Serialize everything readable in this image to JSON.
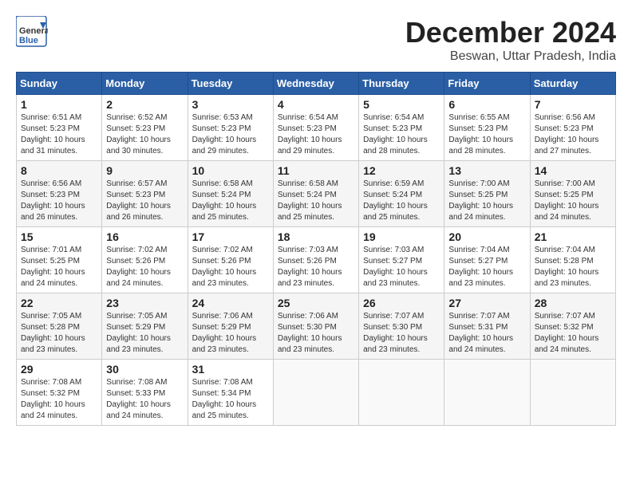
{
  "header": {
    "logo_general": "General",
    "logo_blue": "Blue",
    "month_year": "December 2024",
    "location": "Beswan, Uttar Pradesh, India"
  },
  "weekdays": [
    "Sunday",
    "Monday",
    "Tuesday",
    "Wednesday",
    "Thursday",
    "Friday",
    "Saturday"
  ],
  "weeks": [
    [
      {
        "day": "1",
        "info": "Sunrise: 6:51 AM\nSunset: 5:23 PM\nDaylight: 10 hours\nand 31 minutes."
      },
      {
        "day": "2",
        "info": "Sunrise: 6:52 AM\nSunset: 5:23 PM\nDaylight: 10 hours\nand 30 minutes."
      },
      {
        "day": "3",
        "info": "Sunrise: 6:53 AM\nSunset: 5:23 PM\nDaylight: 10 hours\nand 29 minutes."
      },
      {
        "day": "4",
        "info": "Sunrise: 6:54 AM\nSunset: 5:23 PM\nDaylight: 10 hours\nand 29 minutes."
      },
      {
        "day": "5",
        "info": "Sunrise: 6:54 AM\nSunset: 5:23 PM\nDaylight: 10 hours\nand 28 minutes."
      },
      {
        "day": "6",
        "info": "Sunrise: 6:55 AM\nSunset: 5:23 PM\nDaylight: 10 hours\nand 28 minutes."
      },
      {
        "day": "7",
        "info": "Sunrise: 6:56 AM\nSunset: 5:23 PM\nDaylight: 10 hours\nand 27 minutes."
      }
    ],
    [
      {
        "day": "8",
        "info": "Sunrise: 6:56 AM\nSunset: 5:23 PM\nDaylight: 10 hours\nand 26 minutes."
      },
      {
        "day": "9",
        "info": "Sunrise: 6:57 AM\nSunset: 5:23 PM\nDaylight: 10 hours\nand 26 minutes."
      },
      {
        "day": "10",
        "info": "Sunrise: 6:58 AM\nSunset: 5:24 PM\nDaylight: 10 hours\nand 25 minutes."
      },
      {
        "day": "11",
        "info": "Sunrise: 6:58 AM\nSunset: 5:24 PM\nDaylight: 10 hours\nand 25 minutes."
      },
      {
        "day": "12",
        "info": "Sunrise: 6:59 AM\nSunset: 5:24 PM\nDaylight: 10 hours\nand 25 minutes."
      },
      {
        "day": "13",
        "info": "Sunrise: 7:00 AM\nSunset: 5:25 PM\nDaylight: 10 hours\nand 24 minutes."
      },
      {
        "day": "14",
        "info": "Sunrise: 7:00 AM\nSunset: 5:25 PM\nDaylight: 10 hours\nand 24 minutes."
      }
    ],
    [
      {
        "day": "15",
        "info": "Sunrise: 7:01 AM\nSunset: 5:25 PM\nDaylight: 10 hours\nand 24 minutes."
      },
      {
        "day": "16",
        "info": "Sunrise: 7:02 AM\nSunset: 5:26 PM\nDaylight: 10 hours\nand 24 minutes."
      },
      {
        "day": "17",
        "info": "Sunrise: 7:02 AM\nSunset: 5:26 PM\nDaylight: 10 hours\nand 23 minutes."
      },
      {
        "day": "18",
        "info": "Sunrise: 7:03 AM\nSunset: 5:26 PM\nDaylight: 10 hours\nand 23 minutes."
      },
      {
        "day": "19",
        "info": "Sunrise: 7:03 AM\nSunset: 5:27 PM\nDaylight: 10 hours\nand 23 minutes."
      },
      {
        "day": "20",
        "info": "Sunrise: 7:04 AM\nSunset: 5:27 PM\nDaylight: 10 hours\nand 23 minutes."
      },
      {
        "day": "21",
        "info": "Sunrise: 7:04 AM\nSunset: 5:28 PM\nDaylight: 10 hours\nand 23 minutes."
      }
    ],
    [
      {
        "day": "22",
        "info": "Sunrise: 7:05 AM\nSunset: 5:28 PM\nDaylight: 10 hours\nand 23 minutes."
      },
      {
        "day": "23",
        "info": "Sunrise: 7:05 AM\nSunset: 5:29 PM\nDaylight: 10 hours\nand 23 minutes."
      },
      {
        "day": "24",
        "info": "Sunrise: 7:06 AM\nSunset: 5:29 PM\nDaylight: 10 hours\nand 23 minutes."
      },
      {
        "day": "25",
        "info": "Sunrise: 7:06 AM\nSunset: 5:30 PM\nDaylight: 10 hours\nand 23 minutes."
      },
      {
        "day": "26",
        "info": "Sunrise: 7:07 AM\nSunset: 5:30 PM\nDaylight: 10 hours\nand 23 minutes."
      },
      {
        "day": "27",
        "info": "Sunrise: 7:07 AM\nSunset: 5:31 PM\nDaylight: 10 hours\nand 24 minutes."
      },
      {
        "day": "28",
        "info": "Sunrise: 7:07 AM\nSunset: 5:32 PM\nDaylight: 10 hours\nand 24 minutes."
      }
    ],
    [
      {
        "day": "29",
        "info": "Sunrise: 7:08 AM\nSunset: 5:32 PM\nDaylight: 10 hours\nand 24 minutes."
      },
      {
        "day": "30",
        "info": "Sunrise: 7:08 AM\nSunset: 5:33 PM\nDaylight: 10 hours\nand 24 minutes."
      },
      {
        "day": "31",
        "info": "Sunrise: 7:08 AM\nSunset: 5:34 PM\nDaylight: 10 hours\nand 25 minutes."
      },
      null,
      null,
      null,
      null
    ]
  ]
}
